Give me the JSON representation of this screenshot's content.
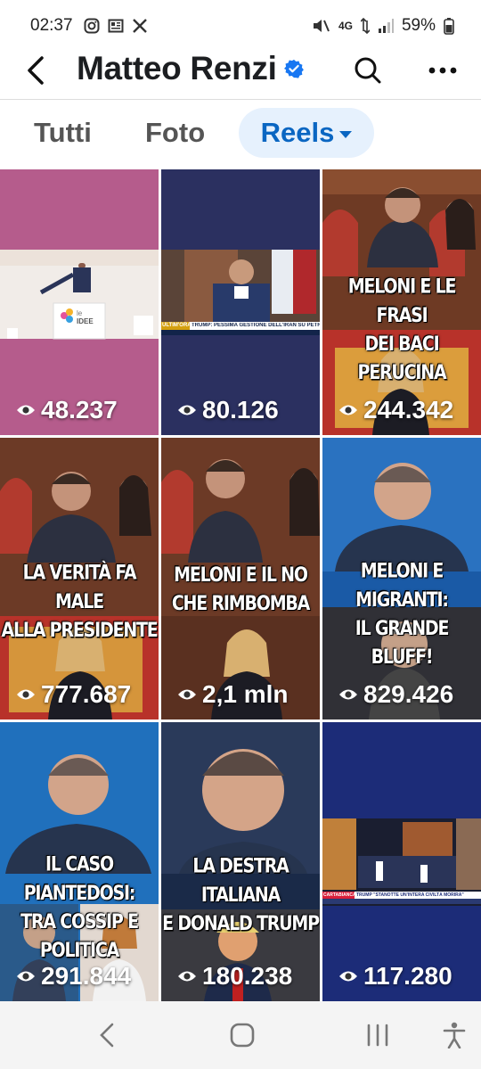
{
  "status": {
    "time": "02:37",
    "network": "4G",
    "battery": "59%",
    "left_icons": [
      "instagram-icon",
      "news-icon",
      "x-icon"
    ],
    "right_icons": [
      "mute-icon",
      "data-arrows-icon",
      "signal-icon",
      "battery-icon"
    ]
  },
  "header": {
    "title": "Matteo Renzi",
    "verified": true,
    "accent": "#1877f2"
  },
  "tabs": [
    {
      "label": "Tutti",
      "active": false
    },
    {
      "label": "Foto",
      "active": false
    },
    {
      "label": "Reels",
      "active": true
    }
  ],
  "reels": [
    {
      "views": "48.237",
      "caption": ""
    },
    {
      "views": "80.126",
      "caption": ""
    },
    {
      "views": "244.342",
      "caption": "MELONI E LE FRASI\nDEI BACI PERUCINA"
    },
    {
      "views": "777.687",
      "caption": "LA VERITÀ FA MALE\nALLA PRESIDENTE"
    },
    {
      "views": "2,1 mln",
      "caption": "MELONI E IL NO\nCHE RIMBOMBA"
    },
    {
      "views": "829.426",
      "caption": "MELONI E MIGRANTI:\nIL GRANDE BLUFF!"
    },
    {
      "views": "291.844",
      "caption": "IL CASO PIANTEDOSI:\nTRA COSSIP E POLITICA"
    },
    {
      "views": "180.238",
      "caption": "LA DESTRA ITALIANA\nE DONALD TRUMP"
    },
    {
      "views": "117.280",
      "caption": ""
    }
  ],
  "inner_text": {
    "stage_logo_small": "le",
    "stage_logo_big": "IDEE",
    "tv_ticker_tag": "ULTIM'ORA",
    "tv_ticker": "TRUMP: PESSIMA GESTIONE DELL'IRAN SU PETROLIO A HORMUZ",
    "tv_ticker_2": "TRUMP \"STANOTTE UN'INTERA CIVILTÀ MORIRÀ\"",
    "tv_ticker_2_tag": "CARTABIANCA"
  },
  "nav": [
    "back-nav",
    "home-nav",
    "recents-nav",
    "accessibility-nav"
  ]
}
